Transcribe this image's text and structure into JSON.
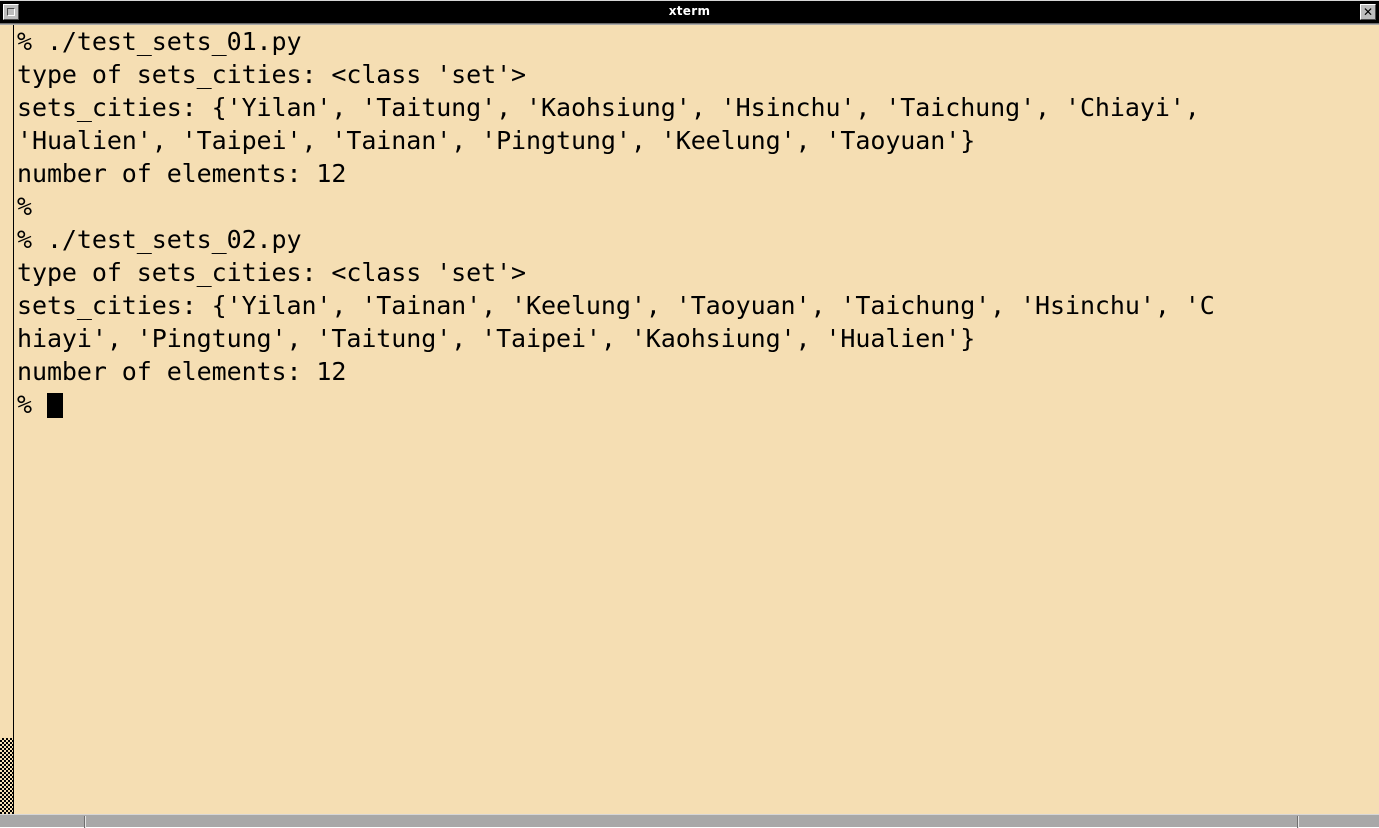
{
  "window": {
    "title": "xterm",
    "menu_icon": "window-menu-icon",
    "close_icon": "✕",
    "background_color": "#f5deb3",
    "foreground_color": "#000000",
    "titlebar_color": "#000000",
    "frame_color": "#a8a8a8"
  },
  "scrollbar": {
    "orientation": "vertical",
    "position": "left",
    "thumb_top_percent": 90,
    "thumb_height_percent": 10
  },
  "terminal": {
    "prompt": "%",
    "cursor": "block",
    "lines": [
      "% ./test_sets_01.py",
      "type of sets_cities: <class 'set'>",
      "sets_cities: {'Yilan', 'Taitung', 'Kaohsiung', 'Hsinchu', 'Taichung', 'Chiayi',",
      "'Hualien', 'Taipei', 'Tainan', 'Pingtung', 'Keelung', 'Taoyuan'}",
      "number of elements: 12",
      "%",
      "% ./test_sets_02.py",
      "type of sets_cities: <class 'set'>",
      "sets_cities: {'Yilan', 'Tainan', 'Keelung', 'Taoyuan', 'Taichung', 'Hsinchu', 'C",
      "hiayi', 'Pingtung', 'Taitung', 'Taipei', 'Kaohsiung', 'Hualien'}",
      "number of elements: 12"
    ],
    "last_line_prompt": "% "
  }
}
